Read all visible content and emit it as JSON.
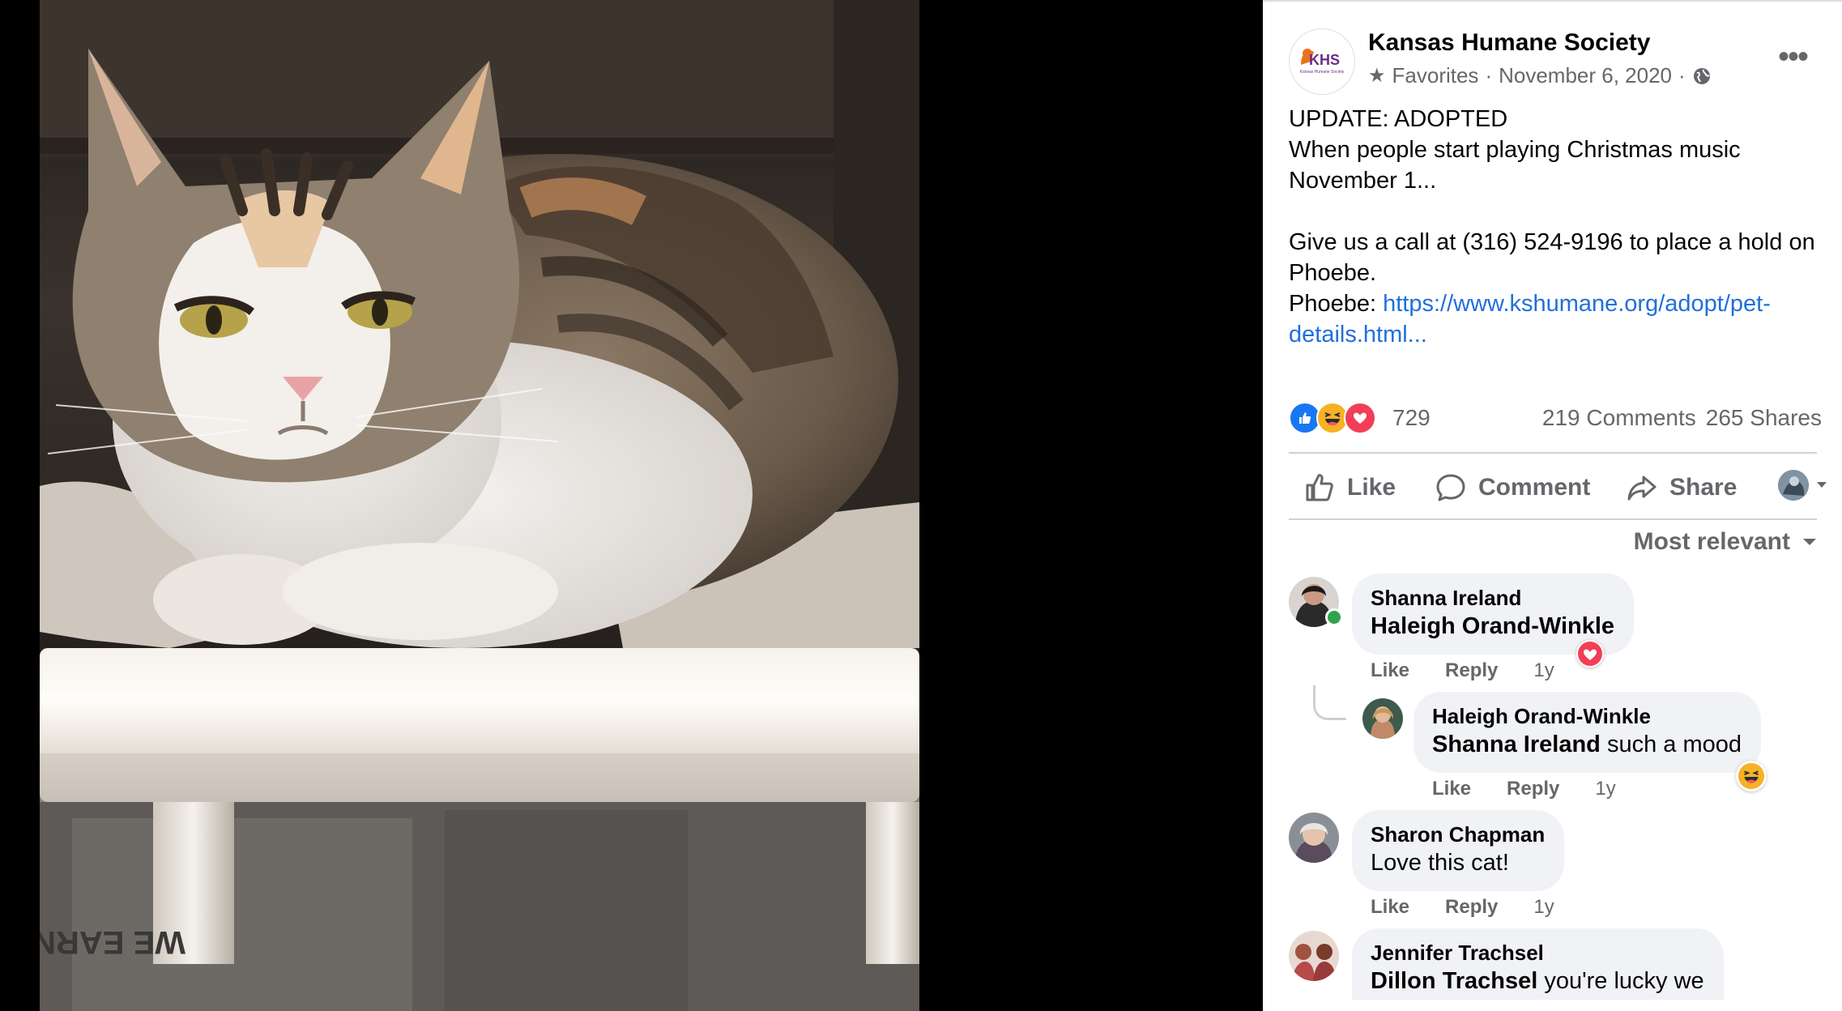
{
  "page": {
    "name": "Kansas Humane Society",
    "logo_text": "KHS",
    "logo_subtext": "Kansas Humane Society",
    "audience": "Favorites",
    "date": "November 6, 2020",
    "separator": "·",
    "more_label": "•••"
  },
  "post": {
    "line1": "UPDATE: ADOPTED",
    "line2": "When people start playing Christmas music November 1...",
    "line3": "Give us a call at (316) 524-9196 to place a hold on Phoebe.",
    "line4_prefix": "Phoebe: ",
    "line4_link": "https://www.kshumane.org/adopt/pet-details.html..."
  },
  "stats": {
    "reaction_count": "729",
    "comments": "219 Comments",
    "shares": "265 Shares"
  },
  "actions": {
    "like": "Like",
    "comment": "Comment",
    "share": "Share"
  },
  "sort_label": "Most relevant",
  "comments": [
    {
      "author": "Shanna Ireland",
      "tag": "Haleigh Orand-Winkle",
      "text": "",
      "like": "Like",
      "reply": "Reply",
      "time": "1y"
    },
    {
      "author": "Haleigh Orand-Winkle",
      "tag": "Shanna Ireland",
      "text": " such a mood",
      "like": "Like",
      "reply": "Reply",
      "time": "1y"
    },
    {
      "author": "Sharon Chapman",
      "tag": "",
      "text": "Love this cat!",
      "like": "Like",
      "reply": "Reply",
      "time": "1y"
    },
    {
      "author": "Jennifer Trachsel",
      "tag": "Dillon Trachsel",
      "text": " you're lucky we",
      "like": "",
      "reply": "",
      "time": ""
    }
  ],
  "photo_text": "WE EARNED OUR",
  "colors": {
    "link": "#216fdb",
    "like_blue": "#1877f2",
    "love_red": "#f33e58",
    "haha_yellow": "#f7b125",
    "logo_orange": "#e8731c",
    "logo_purple": "#6b2c86"
  }
}
